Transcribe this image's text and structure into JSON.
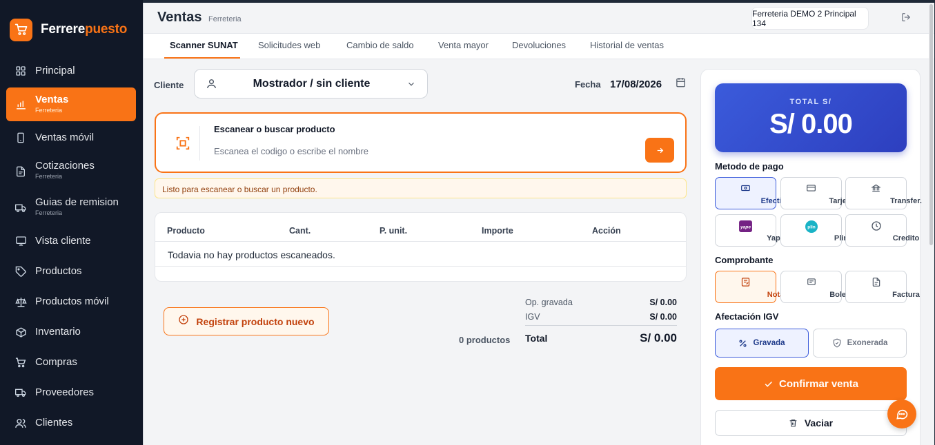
{
  "brand": {
    "name_part1": "Ferrere",
    "name_part2": "puesto",
    "icon": "cart-icon",
    "accent": "#f97316"
  },
  "sidebar": {
    "items": [
      {
        "label": "Principal",
        "sub": "",
        "icon": "grid-icon"
      },
      {
        "label": "Ventas",
        "sub": "Ferreteria",
        "icon": "bar-chart-icon",
        "active": true
      },
      {
        "label": "Ventas móvil",
        "sub": "",
        "icon": "mobile-icon"
      },
      {
        "label": "Cotizaciones",
        "sub": "Ferreteria",
        "icon": "document-icon"
      },
      {
        "label": "Guias de remision",
        "sub": "Ferreteria",
        "icon": "truck-icon"
      },
      {
        "label": "Vista cliente",
        "sub": "",
        "icon": "monitor-icon"
      },
      {
        "label": "Productos",
        "sub": "",
        "icon": "tag-icon"
      },
      {
        "label": "Productos móvil",
        "sub": "",
        "icon": "scale-icon"
      },
      {
        "label": "Inventario",
        "sub": "",
        "icon": "box-icon"
      },
      {
        "label": "Compras",
        "sub": "",
        "icon": "cart-icon"
      },
      {
        "label": "Proveedores",
        "sub": "",
        "icon": "truck-icon"
      },
      {
        "label": "Clientes",
        "sub": "",
        "icon": "users-icon"
      }
    ]
  },
  "header": {
    "title": "Ventas",
    "subtitle": "Ferreteria",
    "branch": "Ferreteria DEMO 2 Principal 134",
    "logout_icon": "logout-icon"
  },
  "tabs": [
    {
      "label": "Scanner SUNAT",
      "active": true
    },
    {
      "label": "Solicitudes web"
    },
    {
      "label": "Cambio de saldo"
    },
    {
      "label": "Venta mayor"
    },
    {
      "label": "Devoluciones"
    },
    {
      "label": "Historial de ventas"
    }
  ],
  "cliente": {
    "label": "Cliente",
    "value": "Mostrador / sin cliente"
  },
  "fecha": {
    "label": "Fecha",
    "value": "17/08/2026"
  },
  "scanner": {
    "title": "Escanear o buscar producto",
    "placeholder": "Escanea el codigo o escribe el nombre",
    "status": "Listo para escanear o buscar un producto."
  },
  "table": {
    "columns": [
      "Producto",
      "Cant.",
      "P. unit.",
      "Importe",
      "Acción"
    ],
    "empty": "Todavia no hay productos escaneados."
  },
  "register_button": "Registrar producto nuevo",
  "summary": {
    "count": "0 productos",
    "op_gravada_label": "Op. gravada",
    "op_gravada": "S/ 0.00",
    "igv_label": "IGV",
    "igv": "S/ 0.00",
    "total_label": "Total",
    "total": "S/ 0.00"
  },
  "panel": {
    "total_label": "TOTAL S/",
    "total_value": "S/ 0.00",
    "metodo_title": "Metodo de pago",
    "metodos": [
      {
        "label": "Efectivo",
        "icon": "cash-icon",
        "selected": true
      },
      {
        "label": "Tarjeta",
        "icon": "card-icon"
      },
      {
        "label": "Transfer.",
        "icon": "bank-icon"
      },
      {
        "label": "Yape",
        "icon": "yape-icon"
      },
      {
        "label": "Plin",
        "icon": "plin-icon"
      },
      {
        "label": "Credito",
        "icon": "clock-icon"
      }
    ],
    "comprobante_title": "Comprobante",
    "comprobantes": [
      {
        "label": "Nota",
        "icon": "note-icon",
        "selected": true
      },
      {
        "label": "Boleta",
        "icon": "receipt-icon"
      },
      {
        "label": "Factura",
        "icon": "invoice-icon"
      }
    ],
    "igv_title": "Afectación IGV",
    "igv_options": [
      {
        "label": "Gravada",
        "icon": "percent-icon",
        "selected": true
      },
      {
        "label": "Exonerada",
        "icon": "shield-icon"
      }
    ],
    "confirm": "Confirmar venta",
    "clear": "Vaciar"
  }
}
